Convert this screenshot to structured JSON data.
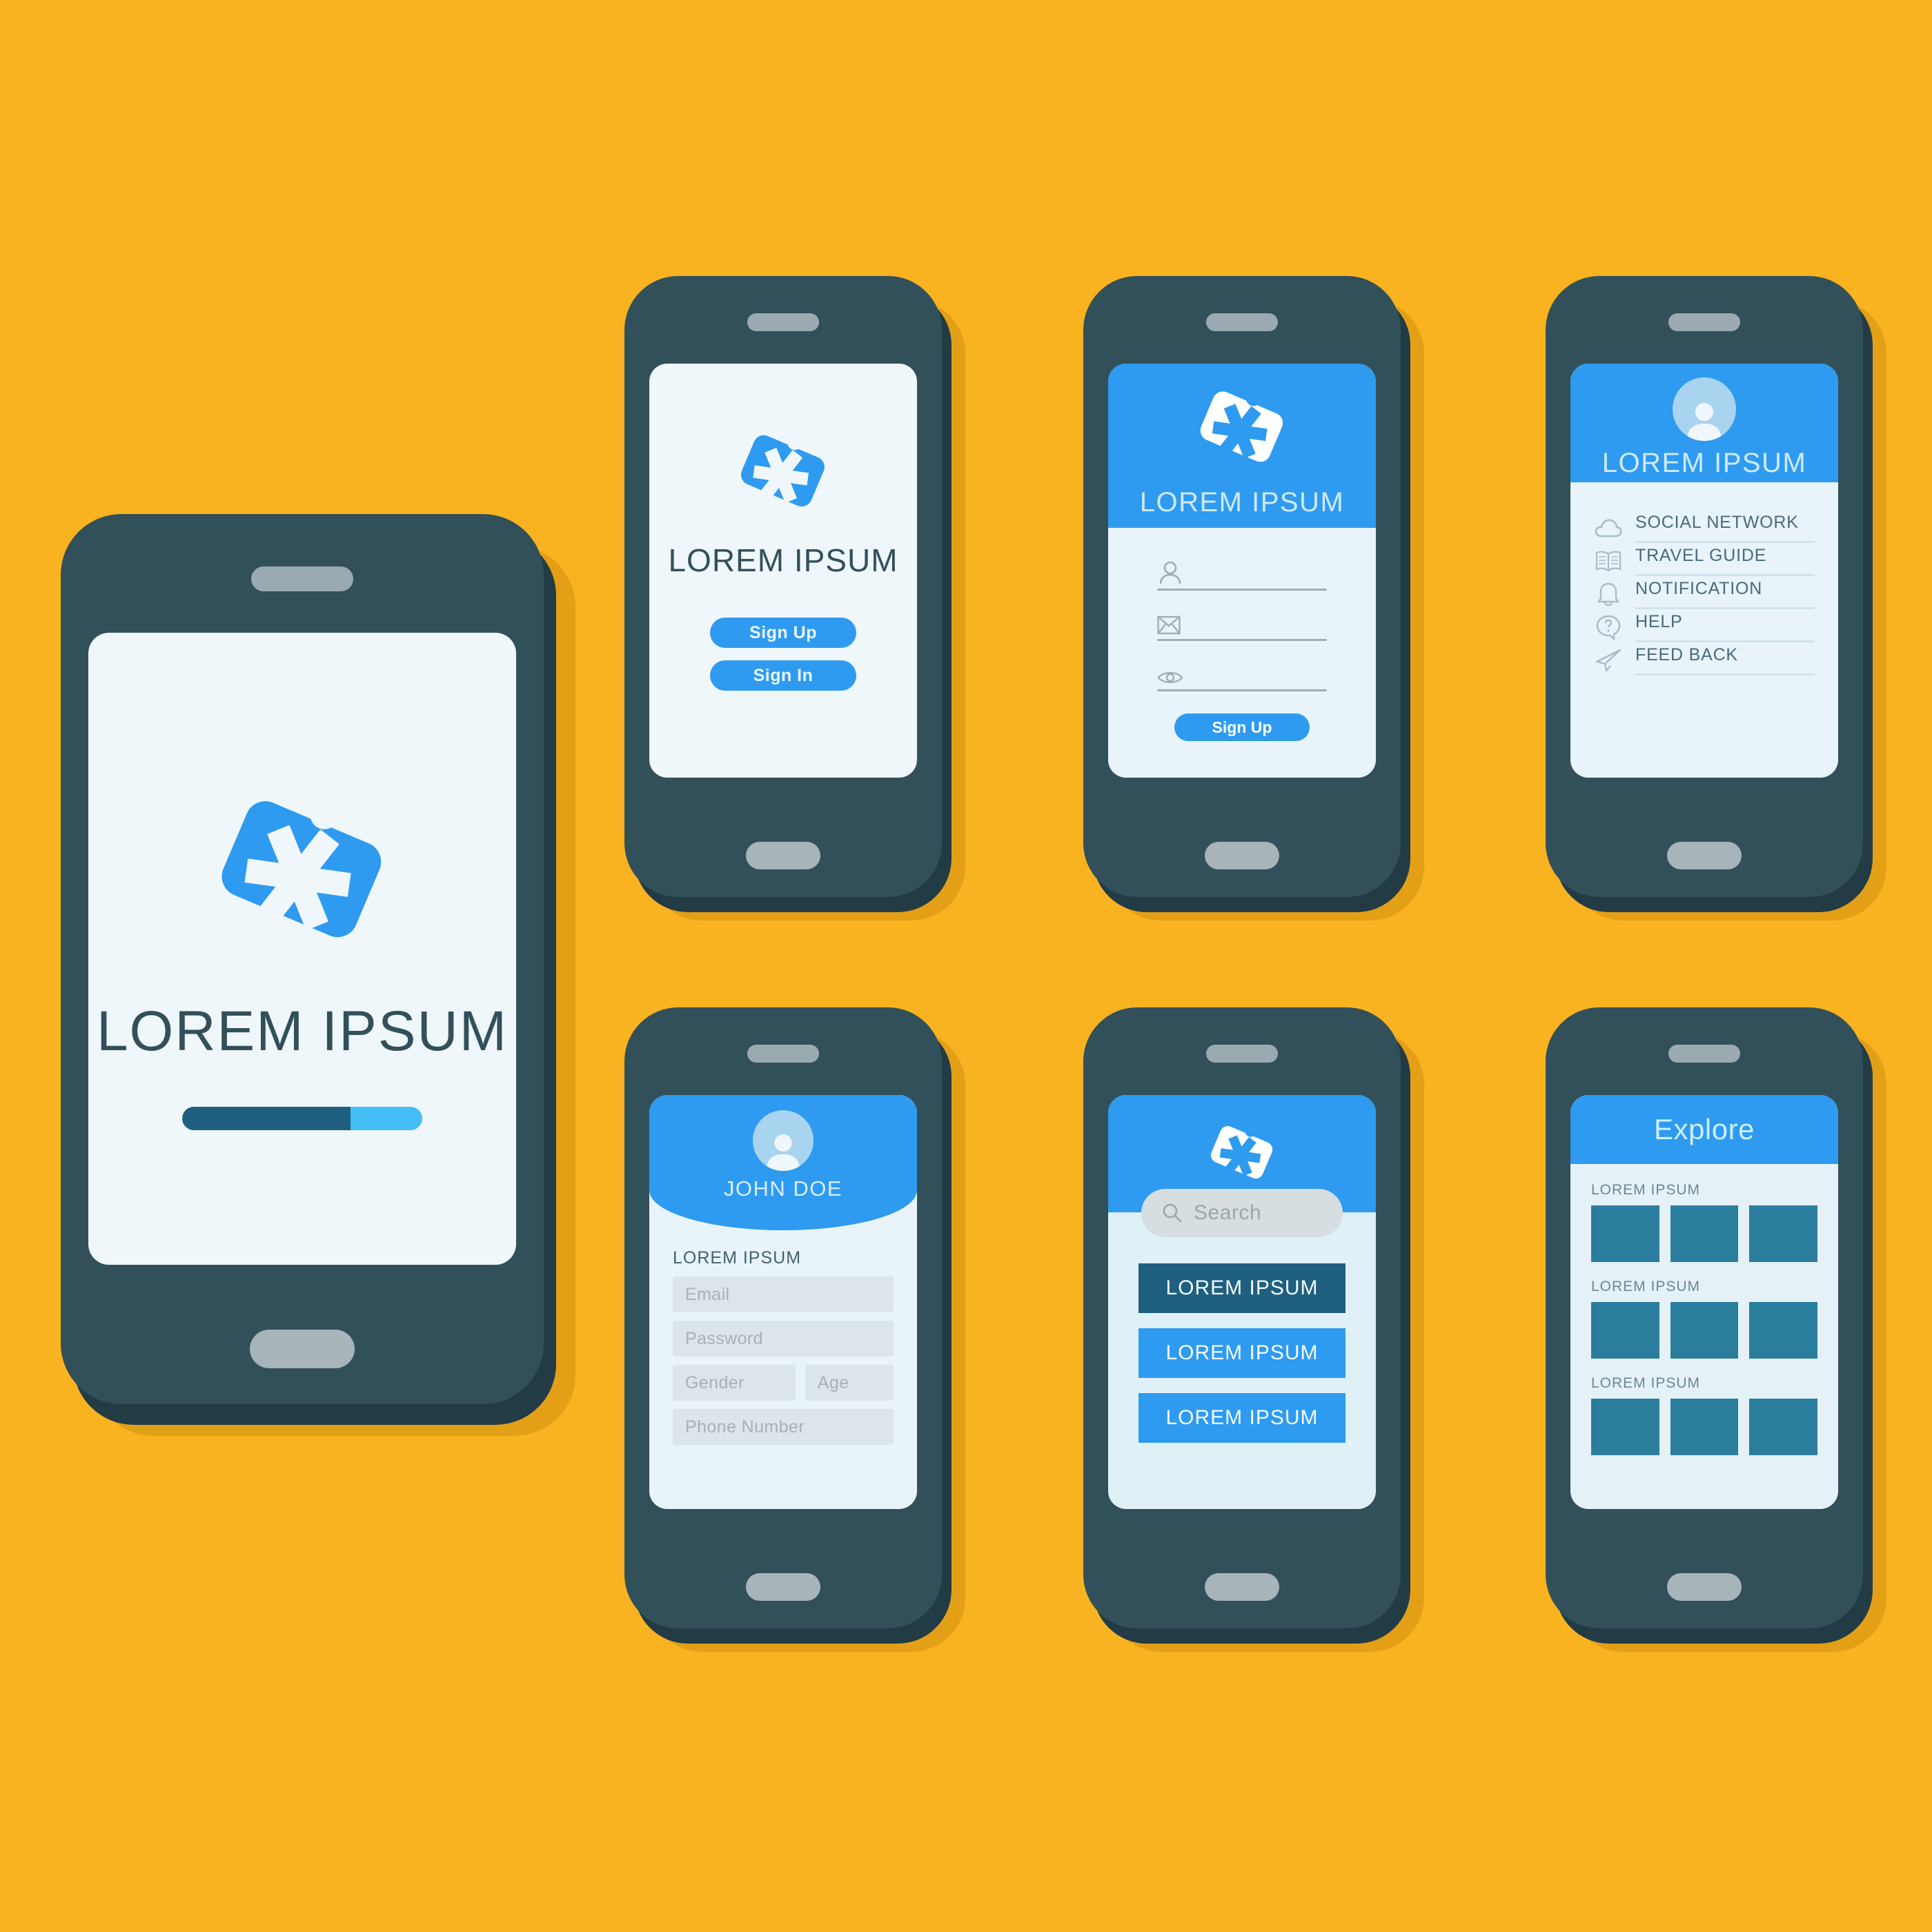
{
  "theme": {
    "background": "#F9B321",
    "phone_body": "#32505A",
    "phone_edge": "#223B45",
    "screen_bg": "#F0F7FB",
    "accent_blue": "#2E9BF0",
    "dark_teal": "#1F6080",
    "tile_teal": "#2B7D9E",
    "light_blue": "#45BDF5"
  },
  "splash_screen": {
    "name": "splash",
    "logo_icon": "tag-asterisk-icon",
    "title": "LOREM IPSUM",
    "progress_percent": 70
  },
  "auth_screen": {
    "name": "auth",
    "logo_icon": "tag-asterisk-icon",
    "title": "LOREM IPSUM",
    "buttons": [
      {
        "label": "Sign Up",
        "icon": ""
      },
      {
        "label": "Sign In",
        "icon": ""
      }
    ]
  },
  "signup_screen": {
    "name": "signup",
    "logo_icon": "tag-asterisk-icon",
    "header_title": "LOREM IPSUM",
    "fields": [
      {
        "icon": "person-icon",
        "value": "",
        "placeholder": ""
      },
      {
        "icon": "envelope-icon",
        "value": "",
        "placeholder": ""
      },
      {
        "icon": "eye-icon",
        "value": "",
        "placeholder": ""
      }
    ],
    "submit_label": "Sign Up"
  },
  "menu_screen": {
    "name": "menu",
    "avatar_icon": "user-avatar-icon",
    "header_title": "LOREM IPSUM",
    "items": [
      {
        "icon": "cloud-icon",
        "label": "SOCIAL NETWORK"
      },
      {
        "icon": "book-icon",
        "label": "TRAVEL GUIDE"
      },
      {
        "icon": "bell-icon",
        "label": "NOTIFICATION"
      },
      {
        "icon": "question-chat-icon",
        "label": "HELP"
      },
      {
        "icon": "paper-plane-icon",
        "label": "FEED BACK"
      }
    ]
  },
  "profile_screen": {
    "name": "profile",
    "avatar_icon": "user-avatar-icon",
    "user_name": "JOHN DOE",
    "section_label": "LOREM IPSUM",
    "fields": [
      {
        "placeholder": "Email",
        "value": ""
      },
      {
        "placeholder": "Password",
        "value": ""
      },
      {
        "placeholder": "Gender",
        "value": ""
      },
      {
        "placeholder": "Age",
        "value": ""
      },
      {
        "placeholder": "Phone Number",
        "value": ""
      }
    ]
  },
  "search_screen": {
    "name": "search",
    "logo_icon": "tag-asterisk-icon",
    "search": {
      "placeholder": "Search",
      "value": "",
      "icon": "magnifier-icon"
    },
    "items": [
      {
        "label": "LOREM IPSUM",
        "color": "#1F6080"
      },
      {
        "label": "LOREM IPSUM",
        "color": "#2E9BF0"
      },
      {
        "label": "LOREM IPSUM",
        "color": "#2E9BF0"
      }
    ]
  },
  "explore_screen": {
    "name": "explore",
    "title": "Explore",
    "groups": [
      {
        "label": "LOREM IPSUM",
        "cells": [
          "",
          "",
          ""
        ]
      },
      {
        "label": "LOREM IPSUM",
        "cells": [
          "",
          "",
          ""
        ]
      },
      {
        "label": "LOREM IPSUM",
        "cells": [
          "",
          "",
          ""
        ]
      }
    ]
  }
}
